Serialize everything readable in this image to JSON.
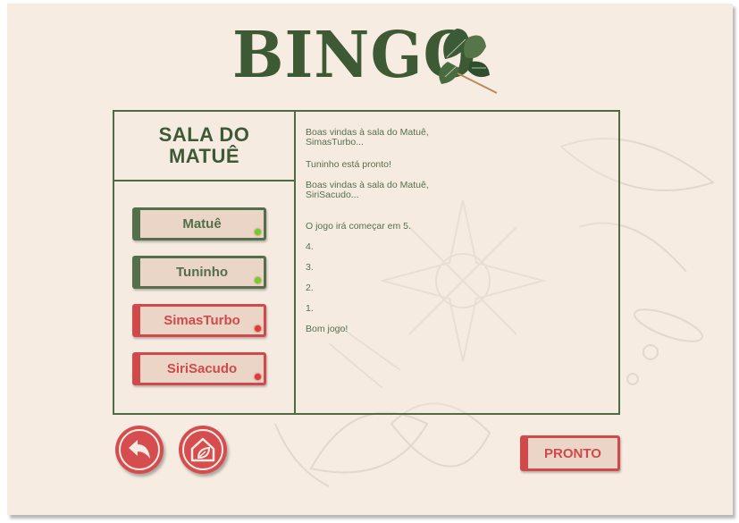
{
  "app": {
    "title": "BINGO",
    "colors": {
      "green": "#3d5a35",
      "red": "#d04a4c",
      "background": "#f6ece1",
      "ready_dot": "#7acb2a",
      "not_ready_dot": "#e23a3a"
    }
  },
  "room": {
    "title": "SALA DO MATUÊ"
  },
  "players": [
    {
      "name": "Matuê",
      "status": "ready"
    },
    {
      "name": "Tuninho",
      "status": "ready"
    },
    {
      "name": "SimasTurbo",
      "status": "not-ready"
    },
    {
      "name": "SiriSacudo",
      "status": "not-ready"
    }
  ],
  "chat": {
    "messages": [
      "Boas vindas à sala do Matuê, SimasTurbo...",
      "Tuninho está pronto!",
      "Boas vindas à sala do Matuê, SiriSacudo...",
      "O jogo irá começar em 5.",
      "4.",
      "3.",
      "2.",
      "1.",
      "Bom jogo!"
    ]
  },
  "actions": {
    "back_icon": "back-arrow-icon",
    "home_icon": "home-leaf-icon",
    "ready_label": "PRONTO"
  }
}
